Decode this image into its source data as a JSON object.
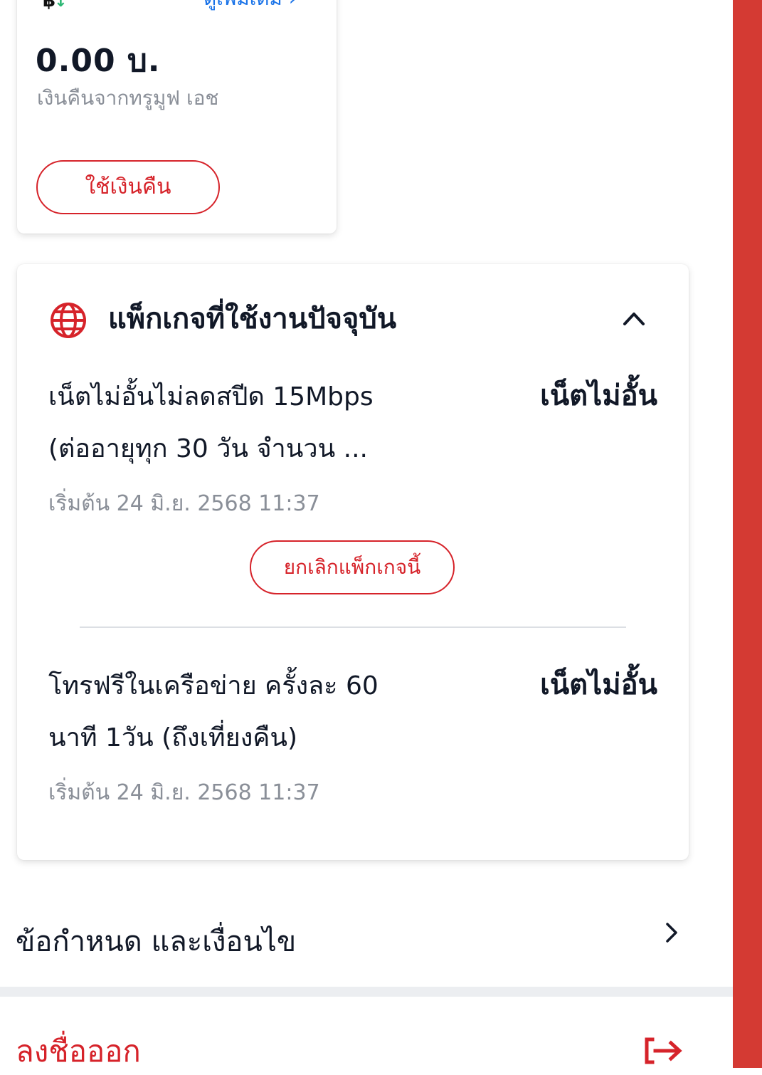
{
  "colors": {
    "accent_red": "#d6232a",
    "side_bar": "#d43a33",
    "link_blue": "#1a73e8",
    "muted_text": "#8a8f98"
  },
  "cashback": {
    "icon": "baht-refund-icon",
    "see_more": "ดูเพิ่มเติม",
    "amount": "0.00 บ.",
    "label": "เงินคืนจากทรูมูฟ เอช",
    "use_button": "ใช้เงินคืน"
  },
  "packages": {
    "icon": "globe-icon",
    "title": "แพ็กเกจที่ใช้งานปัจจุบัน",
    "items": [
      {
        "name_line1": "เน็ตไม่อั้นไม่ลดสปีด 15Mbps",
        "name_line2": "(ต่ออายุทุก 30 วัน จำนวน ...",
        "type": "เน็ตไม่อั้น",
        "start": "เริ่มต้น 24 มิ.ย. 2568 11:37",
        "cancel_button": "ยกเลิกแพ็กเกจนี้"
      },
      {
        "name_line1": "โทรฟรีในเครือข่าย ครั้งละ 60",
        "name_line2": "นาที 1วัน (ถึงเที่ยงคืน)",
        "type": "เน็ตไม่อั้น",
        "start": "เริ่มต้น 24 มิ.ย. 2568 11:37"
      }
    ]
  },
  "terms": {
    "label": "ข้อกำหนด และเงื่อนไข"
  },
  "logout": {
    "label": "ลงชื่อออก"
  }
}
